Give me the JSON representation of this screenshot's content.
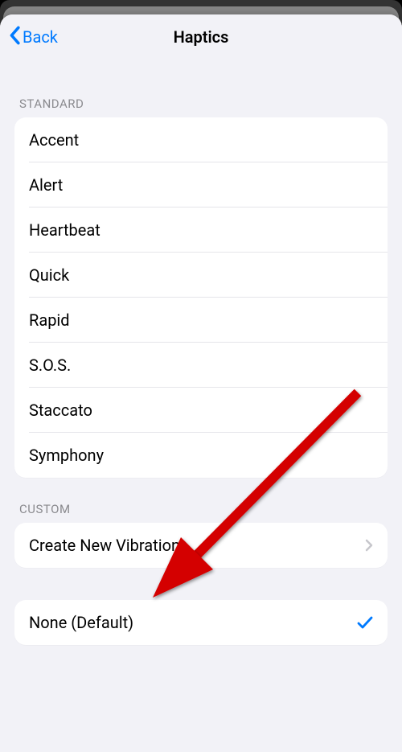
{
  "nav": {
    "back": "Back",
    "title": "Haptics"
  },
  "sections": {
    "standard": {
      "header": "STANDARD",
      "items": [
        "Accent",
        "Alert",
        "Heartbeat",
        "Quick",
        "Rapid",
        "S.O.S.",
        "Staccato",
        "Symphony"
      ]
    },
    "custom": {
      "header": "CUSTOM",
      "createLabel": "Create New Vibration"
    },
    "default": {
      "label": "None (Default)"
    }
  }
}
